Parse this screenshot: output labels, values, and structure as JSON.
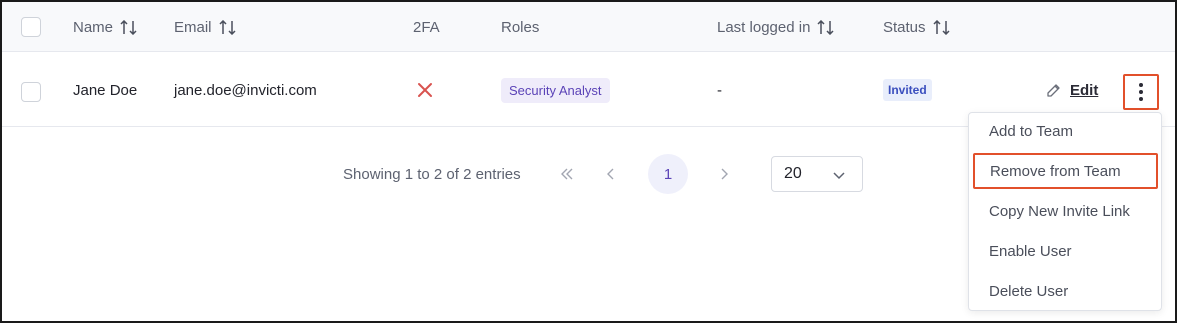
{
  "table": {
    "headers": {
      "name": "Name",
      "email": "Email",
      "twofa": "2FA",
      "roles": "Roles",
      "last_logged_in": "Last logged in",
      "status": "Status"
    },
    "rows": [
      {
        "name": "Jane Doe",
        "email": "jane.doe@invicti.com",
        "twofa": "disabled",
        "role": "Security Analyst",
        "last_logged_in": "-",
        "status": "Invited",
        "edit_label": "Edit"
      }
    ]
  },
  "pagination": {
    "info": "Showing 1 to 2 of 2 entries",
    "current_page": "1",
    "page_size": "20"
  },
  "row_menu": {
    "items": [
      "Add to Team",
      "Remove from Team",
      "Copy New Invite Link",
      "Enable User",
      "Delete User"
    ],
    "highlighted_index": 1
  },
  "colors": {
    "accent": "#5b43b7",
    "highlight_outline": "#e2502b",
    "error_x": "#d9534f"
  }
}
